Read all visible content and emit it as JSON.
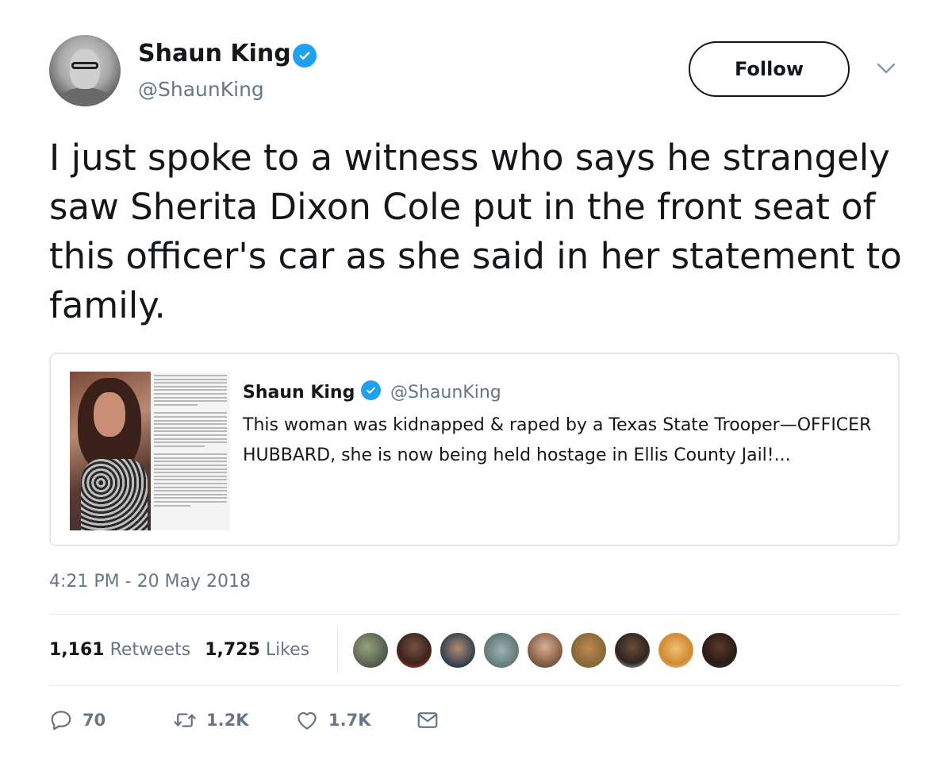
{
  "tweet": {
    "author": {
      "name": "Shaun King",
      "handle": "@ShaunKing",
      "verified": true
    },
    "follow_label": "Follow",
    "text": "I just spoke to a witness who says he strangely saw Sherita Dixon Cole put in the front seat of this officer's car as she said in her statement to family.",
    "quoted": {
      "name": "Shaun King",
      "handle": "@ShaunKing",
      "text": "This woman was kidnapped & raped by a Texas State Trooper—OFFICER HUBBARD, she is now being held hostage in Ellis County Jail!..."
    },
    "timestamp": "4:21 PM - 20 May 2018",
    "stats": {
      "retweets_count": "1,161",
      "retweets_label": "Retweets",
      "likes_count": "1,725",
      "likes_label": "Likes"
    },
    "actions": {
      "reply_count": "70",
      "retweet_count": "1.2K",
      "like_count": "1.7K"
    }
  },
  "colors": {
    "accent": "#1da1f2",
    "text": "#14171a",
    "secondary_text": "#657786",
    "border": "#e1e8ed"
  },
  "icons": [
    "verified-badge-icon",
    "chevron-down-icon",
    "reply-icon",
    "retweet-icon",
    "like-icon",
    "direct-message-icon"
  ]
}
